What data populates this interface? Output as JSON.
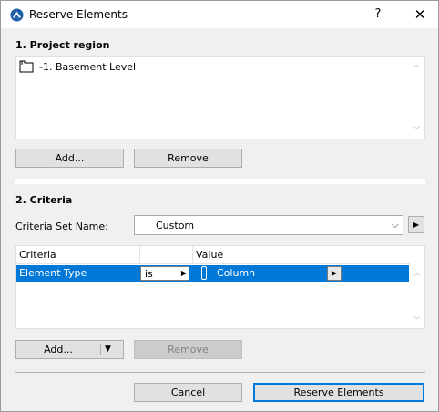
{
  "window": {
    "title": "Reserve Elements",
    "help_label": "?",
    "close_label": "✕"
  },
  "project_region": {
    "heading": "1. Project region",
    "items": [
      {
        "label": "-1. Basement Level",
        "icon": "story-level-icon"
      }
    ],
    "add_label": "Add...",
    "remove_label": "Remove"
  },
  "criteria": {
    "heading": "2. Criteria",
    "set_name_label": "Criteria Set Name:",
    "set_name_value": "Custom",
    "columns": [
      "Criteria",
      "",
      "Value"
    ],
    "rows": [
      {
        "criteria": "Element Type",
        "operator": "is",
        "value": "Column",
        "selected": true
      }
    ],
    "add_label": "Add...",
    "remove_label": "Remove"
  },
  "footer": {
    "cancel_label": "Cancel",
    "reserve_label": "Reserve Elements"
  },
  "colors": {
    "selection": "#0078d7",
    "dialog_bg": "#f0f0f0",
    "button_bg": "#e1e1e1"
  }
}
